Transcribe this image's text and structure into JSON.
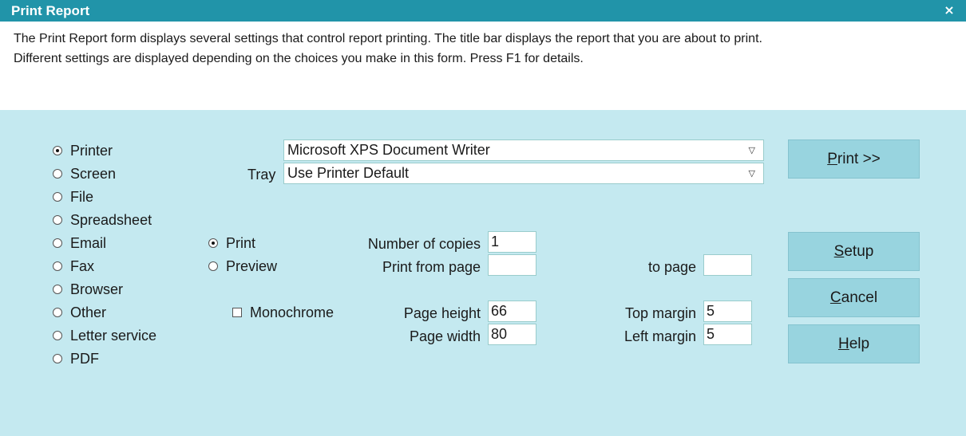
{
  "window": {
    "title": "Print Report",
    "close_glyph": "×"
  },
  "description": {
    "line1": "The Print Report form displays several settings that control report printing. The title bar displays the report that you are about to print.",
    "line2": "Different settings are displayed depending on the choices you make in this form. Press F1 for details."
  },
  "output": {
    "options": [
      {
        "label": "Printer",
        "selected": true
      },
      {
        "label": "Screen",
        "selected": false
      },
      {
        "label": "File",
        "selected": false
      },
      {
        "label": "Spreadsheet",
        "selected": false
      },
      {
        "label": "Email",
        "selected": false
      },
      {
        "label": "Fax",
        "selected": false
      },
      {
        "label": "Browser",
        "selected": false
      },
      {
        "label": "Other",
        "selected": false
      },
      {
        "label": "Letter service",
        "selected": false
      },
      {
        "label": "PDF",
        "selected": false
      }
    ]
  },
  "printer": {
    "value": "Microsoft XPS Document Writer"
  },
  "tray": {
    "label": "Tray",
    "value": "Use Printer Default"
  },
  "mode": {
    "print_label": "Print",
    "preview_label": "Preview",
    "selected": "Print"
  },
  "monochrome": {
    "label": "Monochrome",
    "checked": false
  },
  "fields": {
    "copies_label": "Number of copies",
    "copies_value": "1",
    "from_label": "Print from page",
    "from_value": "",
    "to_label": "to page",
    "to_value": "",
    "height_label": "Page height",
    "height_value": "66",
    "width_label": "Page width",
    "width_value": "80",
    "top_label": "Top margin",
    "top_value": "5",
    "left_label": "Left margin",
    "left_value": "5"
  },
  "buttons": {
    "print": {
      "mnemonic": "P",
      "rest": "rint >>"
    },
    "setup": {
      "mnemonic": "S",
      "rest": "etup"
    },
    "cancel": {
      "mnemonic": "C",
      "rest": "ancel"
    },
    "help": {
      "mnemonic": "H",
      "rest": "elp"
    }
  },
  "colors": {
    "titlebar": "#2194a9",
    "panel": "#c4e9f0",
    "button": "#98d4df"
  }
}
